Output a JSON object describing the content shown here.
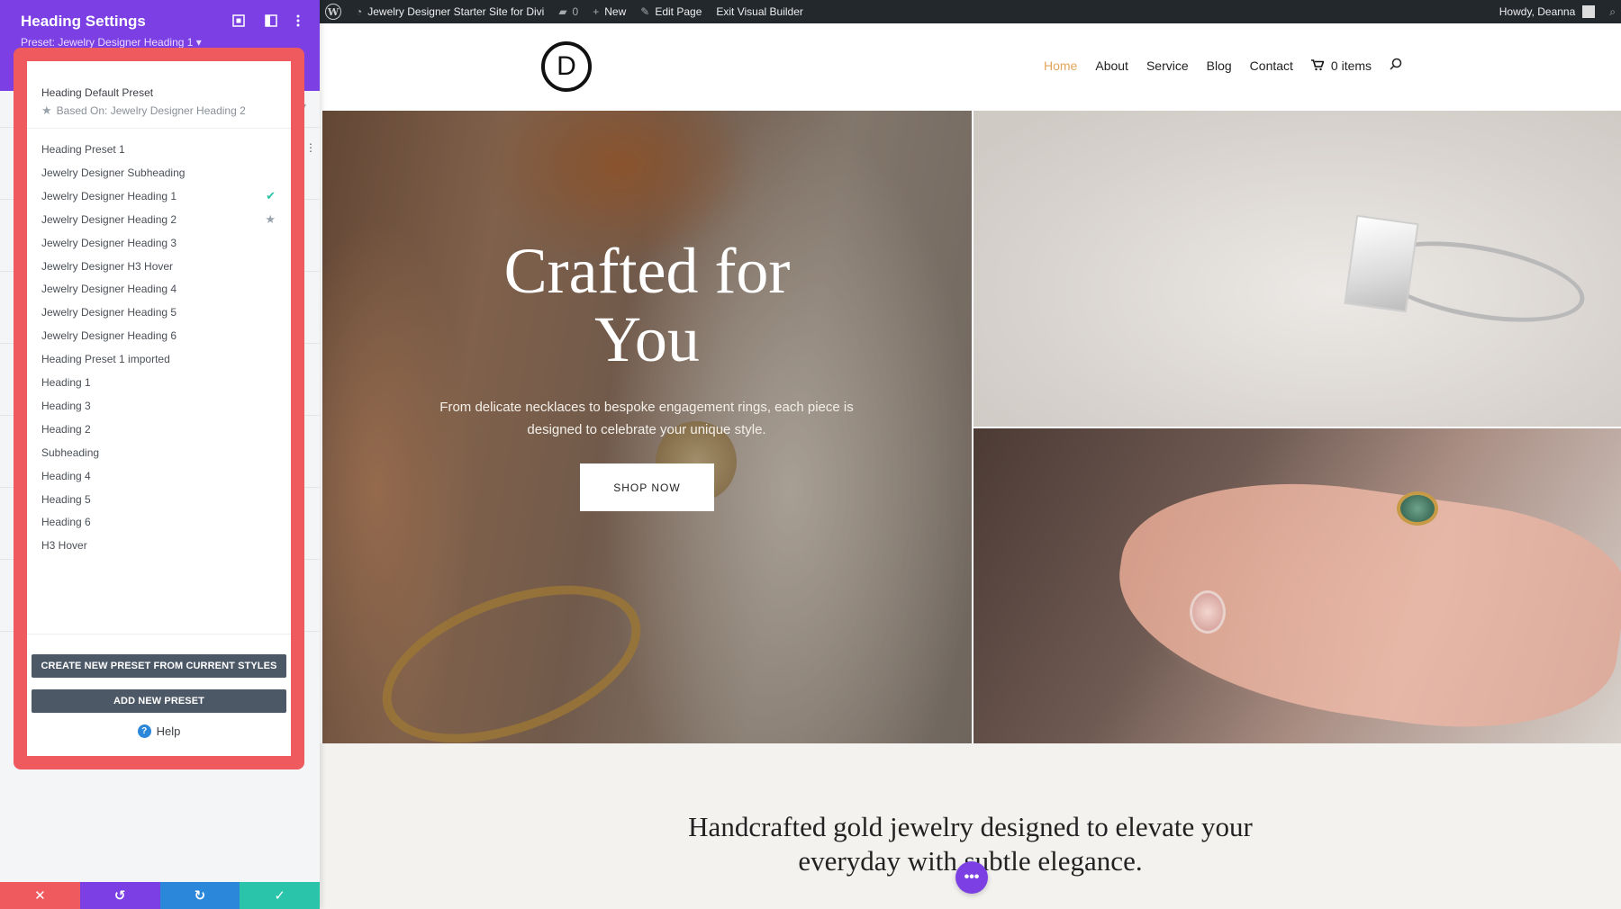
{
  "panel": {
    "title": "Heading Settings",
    "preset_label": "Preset: Jewelry Designer Heading 1 ▾",
    "default_preset": "Heading Default Preset",
    "based_on": "Based On: Jewelry Designer Heading 2",
    "presets": [
      {
        "label": "Heading Preset 1",
        "mark": ""
      },
      {
        "label": "Jewelry Designer Subheading",
        "mark": ""
      },
      {
        "label": "Jewelry Designer Heading 1",
        "mark": "check-icon"
      },
      {
        "label": "Jewelry Designer Heading 2",
        "mark": "star-icon"
      },
      {
        "label": "Jewelry Designer Heading 3",
        "mark": ""
      },
      {
        "label": "Jewelry Designer H3 Hover",
        "mark": ""
      },
      {
        "label": "Jewelry Designer Heading 4",
        "mark": ""
      },
      {
        "label": "Jewelry Designer Heading 5",
        "mark": ""
      },
      {
        "label": "Jewelry Designer Heading 6",
        "mark": ""
      },
      {
        "label": "Heading Preset 1 imported",
        "mark": ""
      },
      {
        "label": "Heading 1",
        "mark": ""
      },
      {
        "label": "Heading 3",
        "mark": ""
      },
      {
        "label": "Heading 2",
        "mark": ""
      },
      {
        "label": "Subheading",
        "mark": ""
      },
      {
        "label": "Heading 4",
        "mark": ""
      },
      {
        "label": "Heading 5",
        "mark": ""
      },
      {
        "label": "Heading 6",
        "mark": ""
      },
      {
        "label": "H3 Hover",
        "mark": ""
      }
    ],
    "create_button": "CREATE NEW PRESET FROM CURRENT STYLES",
    "add_button": "ADD NEW PRESET",
    "help": "Help"
  },
  "adminbar": {
    "site_name": "Jewelry Designer Starter Site for Divi",
    "comments_count": "0",
    "new_label": "New",
    "edit_label": "Edit Page",
    "exit_label": "Exit Visual Builder",
    "howdy": "Howdy, Deanna"
  },
  "site": {
    "logo_letter": "D",
    "nav": [
      "Home",
      "About",
      "Service",
      "Blog",
      "Contact"
    ],
    "cart": "0 items"
  },
  "hero": {
    "title_line1": "Crafted for",
    "title_line2": "You",
    "subtitle": "From delicate necklaces to bespoke engagement rings, each piece is designed to celebrate your unique style.",
    "button": "SHOP NOW"
  },
  "lower": {
    "tagline_line1": "Handcrafted gold jewelry designed to elevate your",
    "tagline_line2": "everyday with subtle elegance."
  },
  "colors": {
    "divi_purple": "#7b3fe4",
    "highlight_red": "#ef5a5f",
    "save_green": "#29c4a9",
    "redo_blue": "#2b87da",
    "nav_active": "#e2a55b"
  }
}
